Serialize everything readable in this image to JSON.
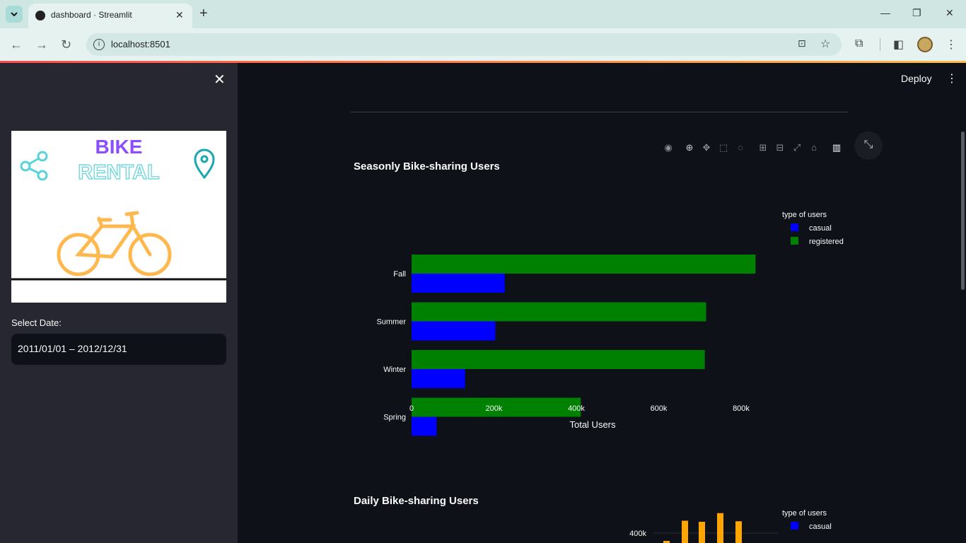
{
  "browser": {
    "tab_title": "dashboard · Streamlit",
    "url": "localhost:8501"
  },
  "sidebar": {
    "logo_text_line1": "BIKE",
    "logo_text_line2": "RENTAL",
    "date_label": "Select Date:",
    "date_value": "2011/01/01 – 2012/12/31"
  },
  "header": {
    "deploy_label": "Deploy"
  },
  "colors": {
    "casual": "#0000ff",
    "registered": "#008000",
    "daily_bar": "#ffa500",
    "background": "#0e1117",
    "sidebar": "#262730"
  },
  "chart_data": [
    {
      "type": "bar",
      "orientation": "horizontal",
      "title": "Seasonly Bike-sharing Users",
      "categories": [
        "Fall",
        "Summer",
        "Winter",
        "Spring"
      ],
      "series": [
        {
          "name": "registered",
          "values": [
            835038,
            715067,
            711831,
            410726
          ]
        },
        {
          "name": "casual",
          "values": [
            226091,
            203522,
            129782,
            60622
          ]
        }
      ],
      "xlabel": "Total Users",
      "ylabel": "",
      "xlim": [
        0,
        900000
      ],
      "x_ticks": [
        "0",
        "200k",
        "400k",
        "600k",
        "800k"
      ],
      "legend_title": "type of users",
      "legend_position": "top-right"
    },
    {
      "type": "bar",
      "title": "Daily Bike-sharing Users",
      "y_ticks": [
        "400k"
      ],
      "legend_title": "type of users",
      "legend_entries": [
        "casual"
      ],
      "visible_values": [
        390000,
        420000,
        400000,
        430000,
        410000
      ]
    }
  ]
}
